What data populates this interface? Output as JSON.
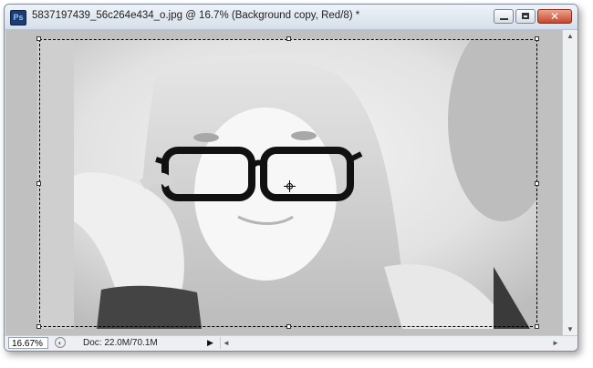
{
  "window": {
    "app_badge": "Ps",
    "title": "5837197439_56c264e434_o.jpg @ 16.7% (Background copy, Red/8) *",
    "buttons": {
      "minimize": "minimize-icon",
      "maximize": "maximize-icon",
      "close": "✕"
    }
  },
  "status": {
    "zoom": "16.67%",
    "doc": "Doc: 22.0M/70.1M",
    "play": "▶",
    "scroll_left": "◄",
    "scroll_right": "►"
  },
  "scrollbar": {
    "up": "▲",
    "down": "▼"
  },
  "colors": {
    "title_bar": "#d6dfe9",
    "canvas_bg": "#c0c0c0",
    "close_button": "#c9452c"
  }
}
